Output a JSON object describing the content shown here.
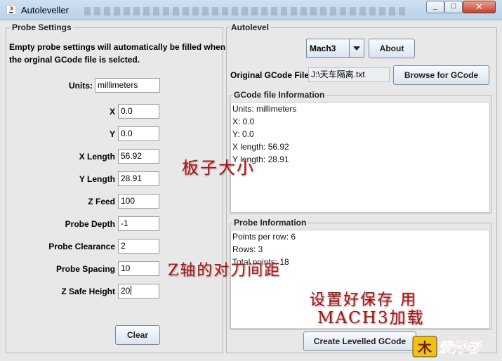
{
  "window": {
    "title": "Autoleveller"
  },
  "probe_settings": {
    "title": "Probe Settings",
    "info": "Empty probe settings will automatically be filled when the orginal GCode file is selcted.",
    "units_label": "Units:",
    "units_value": "millimeters",
    "fields": [
      {
        "label": "X",
        "value": "0.0"
      },
      {
        "label": "Y",
        "value": "0.0"
      },
      {
        "label": "X Length",
        "value": "56.92"
      },
      {
        "label": "Y Length",
        "value": "28.91"
      },
      {
        "label": "Z Feed",
        "value": "100"
      },
      {
        "label": "Probe Depth",
        "value": "-1"
      },
      {
        "label": "Probe Clearance",
        "value": "2"
      },
      {
        "label": "Probe Spacing",
        "value": "10"
      },
      {
        "label": "Z Safe Height",
        "value": "20"
      }
    ],
    "clear_label": "Clear"
  },
  "autolevel": {
    "title": "Autolevel",
    "controller_selected": "Mach3",
    "about_label": "About",
    "gcode_label": "Original GCode File",
    "gcode_value": "J:\\天车隔离.txt",
    "browse_label": "Browse for GCode",
    "gcode_info": {
      "title": "GCode file Information",
      "lines": [
        "Units: millimeters",
        "X: 0.0",
        "Y: 0.0",
        "X length: 56.92",
        "Y length: 28.91"
      ]
    },
    "probe_info": {
      "title": "Probe Information",
      "lines": [
        "Points per row: 6",
        "Rows: 3",
        "Total points: 18"
      ]
    },
    "create_label": "Create Levelled GCode"
  },
  "annotations": {
    "board_size": "板子大小",
    "z_axis": "Z轴的对刀间距",
    "save_1": "设置好保存 用",
    "save_2": "MACH3加载",
    "logo_text": "爱好者"
  },
  "colors": {
    "annotation": "#b01010",
    "titlebar": "#c4d8ee",
    "window_bg": "#e8e8e8"
  }
}
